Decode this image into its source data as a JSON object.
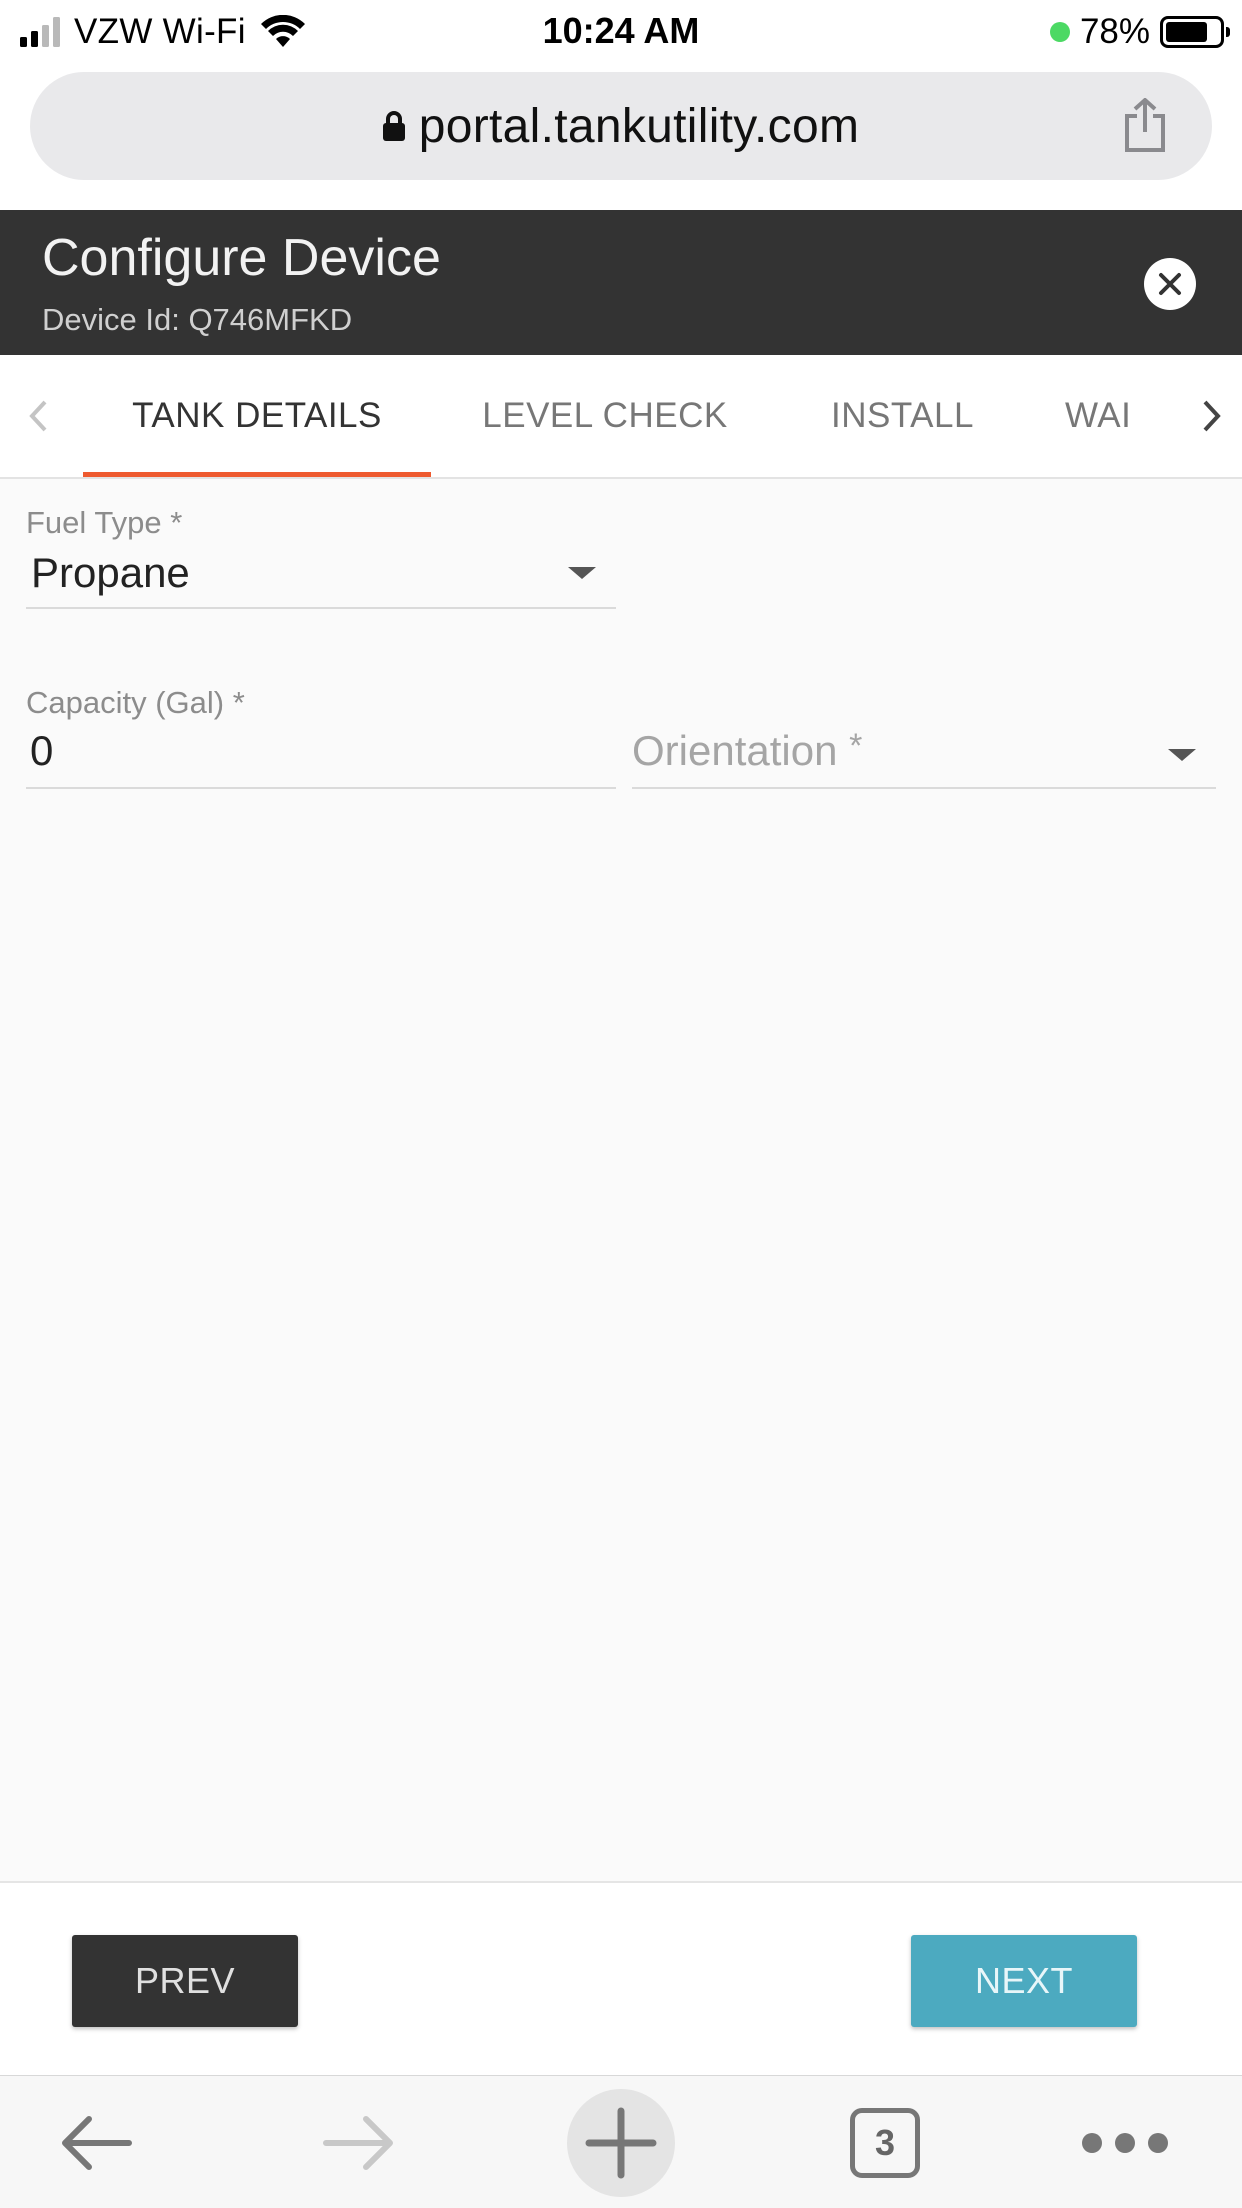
{
  "status_bar": {
    "carrier": "VZW Wi-Fi",
    "time": "10:24 AM",
    "battery_percent": "78%",
    "battery_level": 0.78
  },
  "browser": {
    "url": "portal.tankutility.com",
    "open_tabs_count": "3"
  },
  "header": {
    "title": "Configure Device",
    "subtitle": "Device Id: Q746MFKD"
  },
  "tabs": [
    {
      "label": "TANK DETAILS",
      "active": true
    },
    {
      "label": "LEVEL CHECK",
      "active": false
    },
    {
      "label": "INSTALL",
      "active": false
    },
    {
      "label": "WAI",
      "active": false
    }
  ],
  "form": {
    "fuel_type": {
      "label": "Fuel Type",
      "required_mark": "*",
      "value": "Propane"
    },
    "capacity": {
      "label": "Capacity (Gal)",
      "required_mark": "*",
      "value": "0"
    },
    "orientation": {
      "placeholder": "Orientation",
      "required_mark": "*"
    }
  },
  "footer": {
    "prev_label": "PREV",
    "next_label": "NEXT"
  },
  "colors": {
    "header_bg": "#333333",
    "tab_active_underline": "#ee5a2f",
    "next_button": "#4caac0",
    "prev_button": "#333333"
  }
}
